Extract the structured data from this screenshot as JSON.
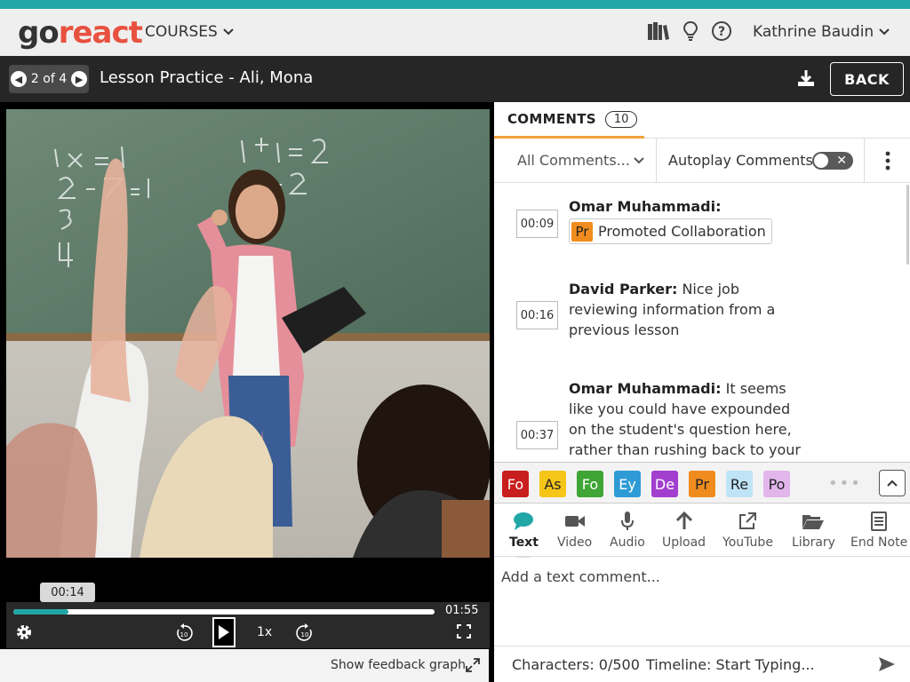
{
  "app": {
    "logo_go": "go",
    "logo_react": "react",
    "nav_courses": "COURSES",
    "user_name": "Kathrine Baudin",
    "icons": [
      "library-icon",
      "lightbulb-icon",
      "help-icon"
    ]
  },
  "session": {
    "pager": "2 of 4",
    "title": "Lesson Practice - Ali, Mona",
    "back_label": "BACK"
  },
  "player": {
    "current_time": "00:14",
    "duration": "01:55",
    "progress_fraction": 0.13,
    "speed": "1x",
    "skip_seconds": "10",
    "feedback_label": "Show feedback graph",
    "colors": {
      "progress": "#22a7a7"
    }
  },
  "comments": {
    "tab_label": "COMMENTS",
    "count": "10",
    "filter": "All Comments...",
    "autoplay_label": "Autoplay Comments",
    "autoplay_on": false,
    "items": [
      {
        "timestamp": "00:09",
        "author": "Omar Muhammadi:",
        "text": "",
        "marker_tag": "Pr",
        "marker_label": "Promoted Collaboration"
      },
      {
        "timestamp": "00:16",
        "author": "David Parker:",
        "text": "Nice job reviewing information from a previous lesson"
      },
      {
        "timestamp": "00:37",
        "author": "Omar Muhammadi:",
        "text": "It seems like you could have expounded on the student's question here, rather than rushing back to your"
      }
    ]
  },
  "markers": [
    {
      "tag": "Fo",
      "bg": "#c81e1e",
      "fg": "#ffffff"
    },
    {
      "tag": "As",
      "bg": "#f5c518",
      "fg": "#222222"
    },
    {
      "tag": "Fo",
      "bg": "#3fa535",
      "fg": "#ffffff"
    },
    {
      "tag": "Ey",
      "bg": "#2e9bd6",
      "fg": "#ffffff"
    },
    {
      "tag": "De",
      "bg": "#a23fcf",
      "fg": "#ffffff"
    },
    {
      "tag": "Pr",
      "bg": "#f08c1e",
      "fg": "#222222"
    },
    {
      "tag": "Re",
      "bg": "#bfe4f5",
      "fg": "#222222"
    },
    {
      "tag": "Po",
      "bg": "#e2b6ea",
      "fg": "#222222"
    }
  ],
  "tools": {
    "text": "Text",
    "video": "Video",
    "audio": "Audio",
    "upload": "Upload",
    "youtube": "YouTube",
    "library": "Library",
    "endnote": "End Note"
  },
  "composer": {
    "placeholder": "Add a text comment...",
    "characters": "Characters: 0/500",
    "timeline": "Timeline:  Start Typing..."
  }
}
